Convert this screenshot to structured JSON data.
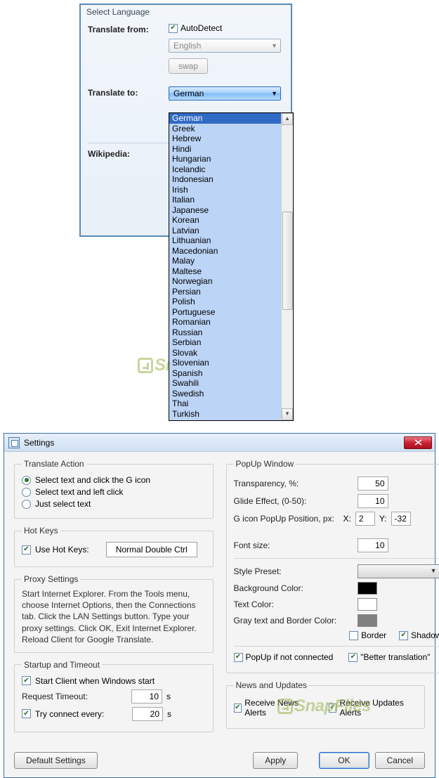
{
  "langPanel": {
    "title": "Select Language",
    "fromLabel": "Translate from:",
    "autoDetectLabel": "AutoDetect",
    "sourceLang": "English",
    "swapLabel": "swap",
    "toLabel": "Translate to:",
    "targetLang": "German",
    "wikiLabel": "Wikipedia:",
    "options": [
      "German",
      "Greek",
      "Hebrew",
      "Hindi",
      "Hungarian",
      "Icelandic",
      "Indonesian",
      "Irish",
      "Italian",
      "Japanese",
      "Korean",
      "Latvian",
      "Lithuanian",
      "Macedonian",
      "Malay",
      "Maltese",
      "Norwegian",
      "Persian",
      "Polish",
      "Portuguese",
      "Romanian",
      "Russian",
      "Serbian",
      "Slovak",
      "Slovenian",
      "Spanish",
      "Swahili",
      "Swedish",
      "Thai",
      "Turkish"
    ],
    "selectedIndex": 0
  },
  "watermark": "SnapFiles",
  "settings": {
    "title": "Settings",
    "translateAction": {
      "legend": "Translate Action",
      "opt1": "Select text and click the G icon",
      "opt2": "Select text and left click",
      "opt3": "Just select text"
    },
    "hotKeys": {
      "legend": "Hot Keys",
      "use": "Use Hot Keys:",
      "value": "Normal Double Ctrl"
    },
    "proxy": {
      "legend": "Proxy Settings",
      "text": "Start Internet Explorer. From the Tools menu, choose Internet Options, then the Connections tab. Click the LAN Settings button. Type your proxy settings. Click OK, Exit Internet Explorer. Reload Client for Google Translate."
    },
    "startup": {
      "legend": "Startup and Timeout",
      "startClient": "Start Client when Windows start",
      "timeoutLabel": "Request Timeout:",
      "timeoutVal": "10",
      "sUnit": "s",
      "tryLabel": "Try connect every:",
      "tryVal": "20"
    },
    "popup": {
      "legend": "PopUp Window",
      "transpLabel": "Transparency, %:",
      "transpVal": "50",
      "glideLabel": "Glide Effect, (0-50):",
      "glideVal": "10",
      "posLabel": "G icon PopUp Position, px:",
      "xLabel": "X:",
      "xVal": "2",
      "yLabel": "Y:",
      "yVal": "-32",
      "fontLabel": "Font size:",
      "fontVal": "10",
      "styleLabel": "Style Preset:",
      "bgLabel": "Background Color:",
      "textColorLabel": "Text Color:",
      "grayLabel": "Gray text and Border Color:",
      "borderLabel": "Border",
      "shadowLabel": "Shadow",
      "popupIf": "PopUp if not connected",
      "better": "\"Better translation\"",
      "bgColor": "#000000",
      "textColor": "#ffffff",
      "grayColor": "#808080"
    },
    "news": {
      "legend": "News and Updates",
      "newsAlerts": "Receive News Alerts",
      "updatesAlerts": "Receive Updates Alerts"
    },
    "buttons": {
      "default": "Default Settings",
      "apply": "Apply",
      "ok": "OK",
      "cancel": "Cancel"
    }
  }
}
